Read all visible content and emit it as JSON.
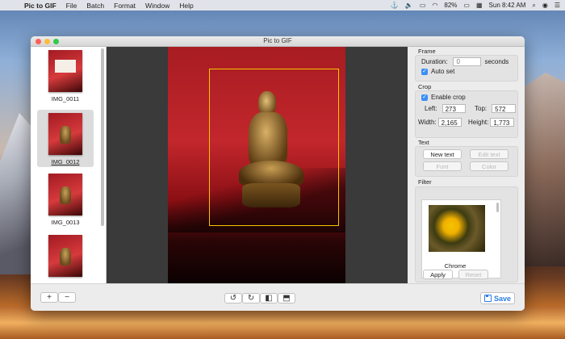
{
  "menubar": {
    "apple_icon": "",
    "app_name": "Pic to GIF",
    "menus": [
      "File",
      "Batch",
      "Format",
      "Window",
      "Help"
    ],
    "battery": "82%",
    "clock": "Sun 8:42 AM"
  },
  "window": {
    "title": "Pic to GIF"
  },
  "thumbnails": [
    {
      "label": "IMG_0011"
    },
    {
      "label": "IMG_0012"
    },
    {
      "label": "IMG_0013"
    }
  ],
  "frame": {
    "section": "Frame",
    "duration_label": "Duration:",
    "duration_placeholder": "0",
    "duration_unit": "seconds",
    "auto_set_label": "Auto set"
  },
  "crop": {
    "section": "Crop",
    "enable_label": "Enable crop",
    "left_label": "Left:",
    "left_value": "273",
    "top_label": "Top:",
    "top_value": "572",
    "width_label": "Width:",
    "width_value": "2,165",
    "height_label": "Height:",
    "height_value": "1,773"
  },
  "text": {
    "section": "Text",
    "new_text": "New text",
    "edit_text": "Edit text",
    "font": "Font",
    "color": "Color"
  },
  "filter": {
    "section": "Filter",
    "selected_name": "Chrome",
    "apply": "Apply",
    "reset": "Reset"
  },
  "toolbar": {
    "add": "+",
    "remove": "−",
    "rotate_left": "↺",
    "rotate_right": "↻",
    "flip_h": "◧",
    "flip_v": "⬒",
    "save_label": "Save"
  }
}
